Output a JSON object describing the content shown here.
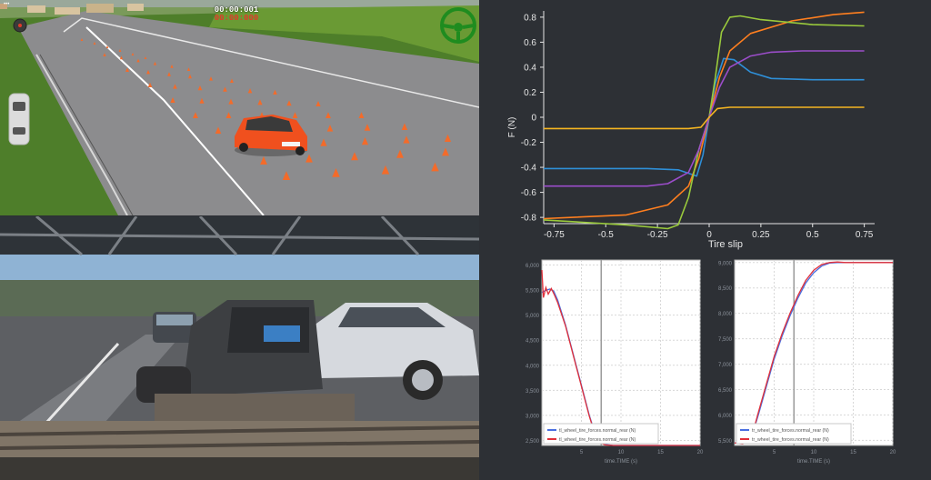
{
  "game": {
    "timer_total": "00:00:001",
    "timer_lap": "00:00:000",
    "cone_count": 60,
    "colors": {
      "car": "#f0501e",
      "grass": "#4e7e2a",
      "track": "#8c8c8e",
      "steering": "#1f8c1f"
    },
    "icons": [
      "steering-wheel-icon",
      "car-topview-icon",
      "minimap-icon"
    ]
  },
  "photo": {
    "description_icons": [
      "motion-platform",
      "cockpit",
      "sedan-car",
      "road"
    ]
  },
  "chart_data": [
    {
      "type": "line",
      "title": "",
      "xlabel": "Tire slip",
      "ylabel": "F (N)",
      "xlim": [
        -0.8,
        0.8
      ],
      "ylim": [
        -0.85,
        0.85
      ],
      "xticks": [
        "-0.75",
        "-0.5",
        "-0.25",
        "0",
        "0.25",
        "0.5",
        "0.75"
      ],
      "yticks": [
        "-0.8",
        "-0.6",
        "-0.4",
        "-0.2",
        "0",
        "0.2",
        "0.4",
        "0.6",
        "0.8"
      ],
      "background": "#2d3035",
      "series": [
        {
          "color": "#2e8fd8",
          "x": [
            -0.8,
            -0.3,
            -0.15,
            -0.06,
            -0.03,
            0,
            0.03,
            0.07,
            0.12,
            0.2,
            0.3,
            0.5,
            0.75
          ],
          "y": [
            -0.41,
            -0.41,
            -0.42,
            -0.47,
            -0.3,
            0,
            0.27,
            0.47,
            0.46,
            0.36,
            0.31,
            0.3,
            0.3
          ]
        },
        {
          "color": "#ff7f1f",
          "x": [
            -0.8,
            -0.4,
            -0.2,
            -0.1,
            -0.05,
            0,
            0.05,
            0.1,
            0.2,
            0.4,
            0.6,
            0.75
          ],
          "y": [
            -0.81,
            -0.78,
            -0.7,
            -0.55,
            -0.33,
            0,
            0.32,
            0.53,
            0.67,
            0.77,
            0.82,
            0.84
          ]
        },
        {
          "color": "#9aca3c",
          "x": [
            -0.8,
            -0.4,
            -0.2,
            -0.15,
            -0.1,
            -0.05,
            0,
            0.03,
            0.06,
            0.1,
            0.15,
            0.25,
            0.5,
            0.75
          ],
          "y": [
            -0.82,
            -0.86,
            -0.89,
            -0.86,
            -0.64,
            -0.26,
            0,
            0.32,
            0.68,
            0.8,
            0.81,
            0.78,
            0.74,
            0.73
          ]
        },
        {
          "color": "#9b4dca",
          "x": [
            -0.8,
            -0.3,
            -0.2,
            -0.1,
            -0.05,
            0,
            0.05,
            0.1,
            0.2,
            0.3,
            0.45,
            0.75
          ],
          "y": [
            -0.55,
            -0.55,
            -0.53,
            -0.44,
            -0.26,
            0,
            0.24,
            0.4,
            0.49,
            0.52,
            0.53,
            0.53
          ]
        },
        {
          "color": "#f5b521",
          "x": [
            -0.8,
            -0.3,
            -0.1,
            -0.04,
            0,
            0.04,
            0.1,
            0.3,
            0.75
          ],
          "y": [
            -0.09,
            -0.09,
            -0.09,
            -0.08,
            0,
            0.07,
            0.08,
            0.08,
            0.08
          ]
        }
      ]
    },
    {
      "type": "line",
      "xlabel": "time.TIME (s)",
      "ylabel": "",
      "xlim": [
        0,
        20
      ],
      "ylim": [
        2400,
        6100
      ],
      "xticks": [
        "5",
        "10",
        "15",
        "20"
      ],
      "yticks": [
        "2,500",
        "3,000",
        "3,500",
        "4,000",
        "4,500",
        "5,000",
        "5,500",
        "6,000"
      ],
      "cursor_x": 7.5,
      "legend": "bottom-left",
      "series": [
        {
          "name": "tl_wheel_tire_forces.normal_rear (N)",
          "color": "#4a6fe0",
          "x": [
            0,
            0.3,
            0.6,
            1,
            1.5,
            2,
            3,
            4,
            5,
            6,
            7,
            8,
            9,
            20
          ],
          "y": [
            5450,
            5480,
            5500,
            5520,
            5480,
            5300,
            4800,
            4200,
            3600,
            3000,
            2500,
            2420,
            2400,
            2400
          ]
        },
        {
          "name": "tl_wheel_tire_forces.normal_rear (N)",
          "color": "#e0303a",
          "x": [
            0,
            0.2,
            0.5,
            0.8,
            1.2,
            1.6,
            2,
            3,
            4,
            5,
            6,
            7,
            8,
            9,
            20
          ],
          "y": [
            5900,
            5350,
            5550,
            5420,
            5530,
            5400,
            5250,
            4780,
            4180,
            3580,
            2980,
            2480,
            2410,
            2400,
            2400
          ]
        }
      ]
    },
    {
      "type": "line",
      "xlabel": "time.TIME (s)",
      "ylabel": "",
      "xlim": [
        0,
        20
      ],
      "ylim": [
        5400,
        9050
      ],
      "xticks": [
        "5",
        "10",
        "15",
        "20"
      ],
      "yticks": [
        "5,500",
        "6,000",
        "6,500",
        "7,000",
        "7,500",
        "8,000",
        "8,500",
        "9,000"
      ],
      "cursor_x": 7.5,
      "legend": "bottom-left",
      "series": [
        {
          "name": "tr_wheel_tire_forces.normal_rear (N)",
          "color": "#4a6fe0",
          "x": [
            0,
            1,
            2,
            3,
            4,
            5,
            6,
            7,
            8,
            9,
            10,
            11,
            12,
            13,
            14,
            20
          ],
          "y": [
            5450,
            5440,
            5500,
            6000,
            6550,
            7100,
            7550,
            7950,
            8300,
            8600,
            8800,
            8930,
            8990,
            9000,
            9000,
            9000
          ]
        },
        {
          "name": "tr_wheel_tire_forces.normal_rear (N)",
          "color": "#e0303a",
          "x": [
            0,
            1,
            2,
            3,
            4,
            5,
            6,
            7,
            8,
            9,
            10,
            11,
            12,
            13,
            14,
            20
          ],
          "y": [
            5450,
            5430,
            5480,
            6050,
            6600,
            7150,
            7600,
            8000,
            8350,
            8650,
            8850,
            8960,
            9000,
            9010,
            9000,
            9000
          ]
        }
      ]
    }
  ]
}
